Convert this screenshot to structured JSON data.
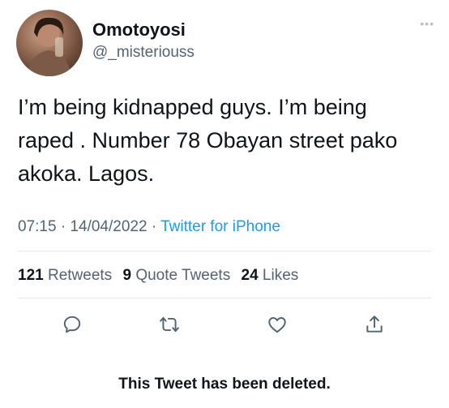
{
  "user": {
    "display_name": "Omotoyosi",
    "handle": "@_misteriouss",
    "avatar_icon": "profile-photo"
  },
  "tweet": {
    "text": "I’m being kidnapped guys. I’m being raped . Number 78 Obayan street pako akoka. Lagos.",
    "time": "07:15",
    "date": "14/04/2022",
    "source": "Twitter for iPhone",
    "sep": "·"
  },
  "stats": {
    "retweets_count": "121",
    "retweets_label": "Retweets",
    "quotes_count": "9",
    "quotes_label": "Quote Tweets",
    "likes_count": "24",
    "likes_label": "Likes"
  },
  "actions": {
    "reply_icon": "reply-icon",
    "retweet_icon": "retweet-icon",
    "like_icon": "like-icon",
    "share_icon": "share-icon"
  },
  "notice": {
    "text": "This Tweet has been deleted."
  },
  "colors": {
    "accent": "#1d9bf0",
    "muted": "#536471",
    "text": "#0f1419",
    "divider": "#e1e8ed"
  }
}
